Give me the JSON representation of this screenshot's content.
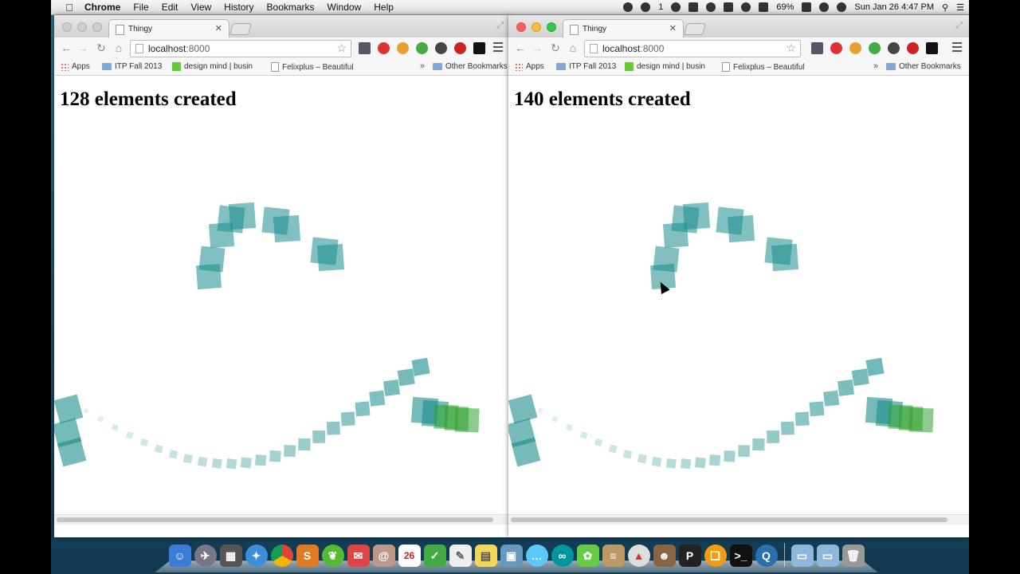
{
  "menubar": {
    "app_name": "Chrome",
    "menus": [
      "File",
      "Edit",
      "View",
      "History",
      "Bookmarks",
      "Window",
      "Help"
    ],
    "notification_count": "1",
    "battery": "69%",
    "clock": "Sun Jan 26  4:47 PM"
  },
  "windows": [
    {
      "state": "inactive",
      "tab_title": "Thingy",
      "url_host": "localhost",
      "url_port": ":8000",
      "bookmarks": [
        "Apps",
        "ITP Fall 2013",
        "design mind | busin",
        "Felixplus – Beautiful"
      ],
      "other_bookmarks": "Other Bookmarks",
      "heading": "128 elements created"
    },
    {
      "state": "active",
      "tab_title": "Thingy",
      "url_host": "localhost",
      "url_port": ":8000",
      "bookmarks": [
        "Apps",
        "ITP Fall 2013",
        "design mind | busin",
        "Felixplus – Beautiful"
      ],
      "other_bookmarks": "Other Bookmarks",
      "heading": "140 elements created"
    }
  ],
  "calendar_dock_day": "26",
  "colors": {
    "teal": "#1a8c8c",
    "green": "#2ea02e",
    "menubar": "#e6e6e6",
    "chrome": "#f6f6f6"
  }
}
